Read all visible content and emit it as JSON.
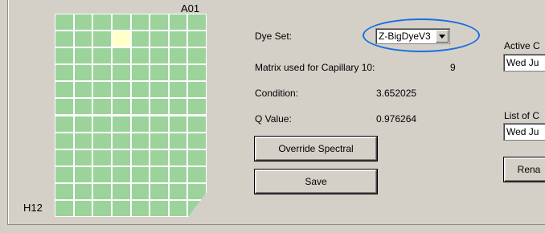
{
  "plate": {
    "corner_top_right": "A01",
    "corner_bottom_left": "H12",
    "columns": 8,
    "rows": 12,
    "selected_well": {
      "row": 1,
      "col": 3
    },
    "well_color": "#9bd39b",
    "selected_color": "#ffffcc"
  },
  "dye_set": {
    "label": "Dye Set:",
    "value": "Z-BigDyeV3"
  },
  "matrix": {
    "label": "Matrix used for Capillary 10:",
    "value": "9"
  },
  "condition": {
    "label": "Condition:",
    "value": "3.652025"
  },
  "q_value": {
    "label": "Q Value:",
    "value": "0.976264"
  },
  "buttons": {
    "override": "Override Spectral",
    "save": "Save",
    "rename": "Rena"
  },
  "active": {
    "label": "Active C",
    "value": "Wed Ju"
  },
  "list": {
    "label": "List of C",
    "value": "Wed Ju"
  },
  "highlight_color": "#1a6ee0"
}
